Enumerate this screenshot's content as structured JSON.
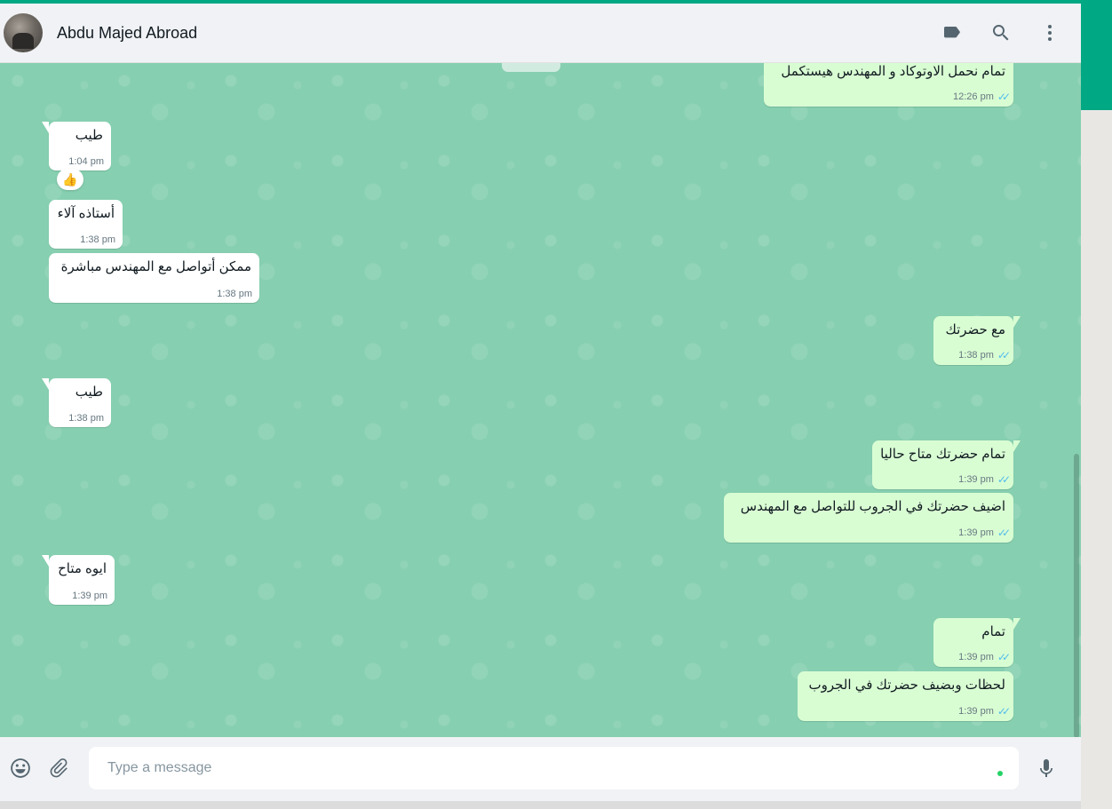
{
  "header": {
    "contact_name": "Abdu Majed Abroad",
    "icons": [
      "label-icon",
      "search-icon",
      "menu-icon"
    ]
  },
  "messages": [
    {
      "dir": "out",
      "text": "تمام نحمل الاوتوكاد و المهندس هيستكمل",
      "time": "12:26 pm",
      "status": "read"
    },
    {
      "dir": "in",
      "text": "طيب",
      "time": "1:04 pm",
      "reaction": "👍"
    },
    {
      "dir": "in",
      "text": "أستاذه آلاء",
      "time": "1:38 pm"
    },
    {
      "dir": "in",
      "text": "ممكن أتواصل مع المهندس مباشرة",
      "time": "1:38 pm"
    },
    {
      "dir": "out",
      "text": "مع حضرتك",
      "time": "1:38 pm",
      "status": "read"
    },
    {
      "dir": "in",
      "text": "طيب",
      "time": "1:38 pm"
    },
    {
      "dir": "out",
      "text": "تمام حضرتك متاح حاليا",
      "time": "1:39 pm",
      "status": "read"
    },
    {
      "dir": "out",
      "text": "اضيف حضرتك في الجروب للتواصل مع المهندس",
      "time": "1:39 pm",
      "status": "read"
    },
    {
      "dir": "in",
      "text": "ايوه متاح",
      "time": "1:39 pm"
    },
    {
      "dir": "out",
      "text": "تمام",
      "time": "1:39 pm",
      "status": "read"
    },
    {
      "dir": "out",
      "text": "لحظات وبضيف حضرتك في الجروب",
      "time": "1:39 pm",
      "status": "read"
    }
  ],
  "composer": {
    "placeholder": "Type a message",
    "icons": [
      "emoji-icon",
      "attach-icon",
      "mic-icon"
    ]
  },
  "colors": {
    "accent": "#00a884",
    "chat_background": "#86cfb0",
    "outgoing_bubble": "#d9fdd3",
    "incoming_bubble": "#ffffff",
    "read_ticks": "#53bdeb"
  }
}
